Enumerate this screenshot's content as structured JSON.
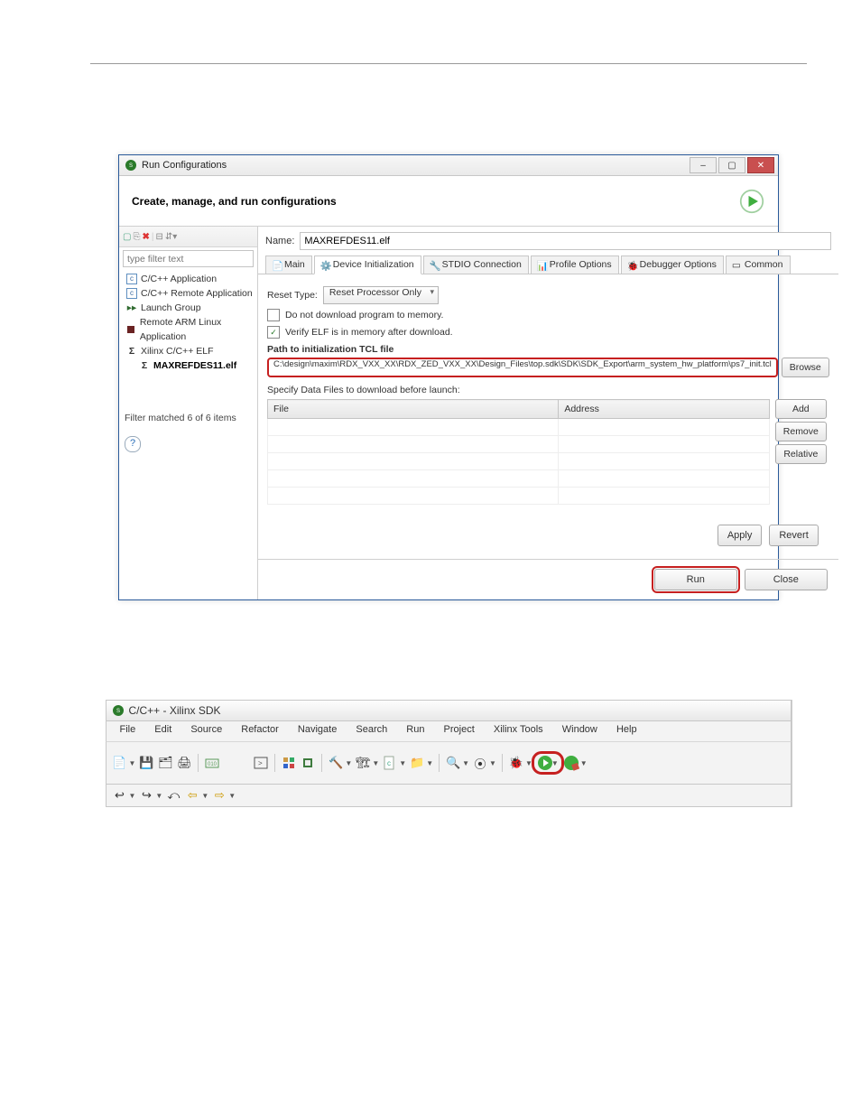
{
  "dialog": {
    "title": "Run Configurations",
    "header": "Create, manage, and run configurations",
    "filter_placeholder": "type filter text",
    "tree": [
      "C/C++ Application",
      "C/C++ Remote Application",
      "Launch Group",
      "Remote ARM Linux Application",
      "Xilinx C/C++ ELF",
      "MAXREFDES11.elf"
    ],
    "filter_match": "Filter matched 6 of 6 items",
    "name_label": "Name:",
    "name_value": "MAXREFDES11.elf",
    "tabs": [
      "Main",
      "Device Initialization",
      "STDIO Connection",
      "Profile Options",
      "Debugger Options",
      "Common"
    ],
    "reset_type_label": "Reset Type:",
    "reset_type_value": "Reset Processor Only",
    "cb_download": "Do not download program to memory.",
    "cb_verify": "Verify ELF is in memory after download.",
    "path_label": "Path to initialization TCL file",
    "path_value": "C:\\design\\maxim\\RDX_VXX_XX\\RDX_ZED_VXX_XX\\Design_Files\\top.sdk\\SDK\\SDK_Export\\arm_system_hw_platform\\ps7_init.tcl",
    "browse": "Browse",
    "specify_label": "Specify Data Files to download before launch:",
    "cols": [
      "File",
      "Address"
    ],
    "side_btns": [
      "Add",
      "Remove",
      "Relative"
    ],
    "apply": "Apply",
    "revert": "Revert",
    "run": "Run",
    "close": "Close"
  },
  "toolbarwin": {
    "title": "C/C++ - Xilinx SDK",
    "menu": [
      "File",
      "Edit",
      "Source",
      "Refactor",
      "Navigate",
      "Search",
      "Run",
      "Project",
      "Xilinx Tools",
      "Window",
      "Help"
    ]
  }
}
